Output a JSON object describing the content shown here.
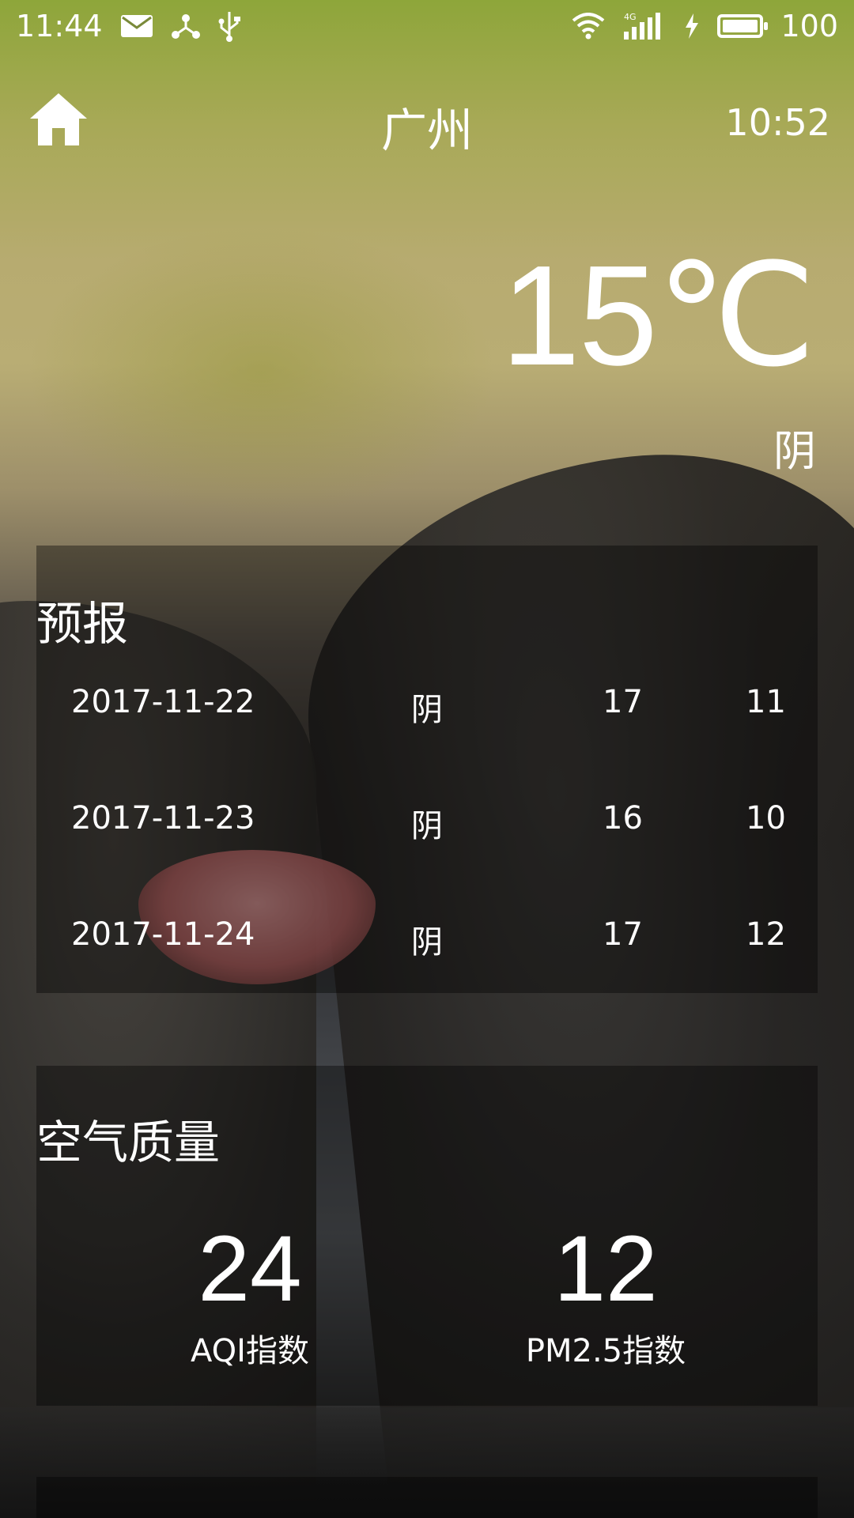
{
  "status_bar": {
    "time": "11:44",
    "battery": "100",
    "network": "4G",
    "icons": [
      "mail-icon",
      "share-icon",
      "usb-icon",
      "wifi-icon",
      "signal-icon",
      "charging-icon",
      "battery-icon"
    ]
  },
  "header": {
    "city": "广州",
    "update_time": "10:52",
    "home_icon": "home-icon"
  },
  "now": {
    "temperature": "15℃",
    "info": "阴"
  },
  "forecast": {
    "title": "预报",
    "items": [
      {
        "date": "2017-11-22",
        "info": "阴",
        "max": "17",
        "min": "11"
      },
      {
        "date": "2017-11-23",
        "info": "阴",
        "max": "16",
        "min": "10"
      },
      {
        "date": "2017-11-24",
        "info": "阴",
        "max": "17",
        "min": "12"
      }
    ]
  },
  "aqi": {
    "title": "空气质量",
    "aqi_value": "24",
    "aqi_label": "AQI指数",
    "pm25_value": "12",
    "pm25_label": "PM2.5指数"
  }
}
